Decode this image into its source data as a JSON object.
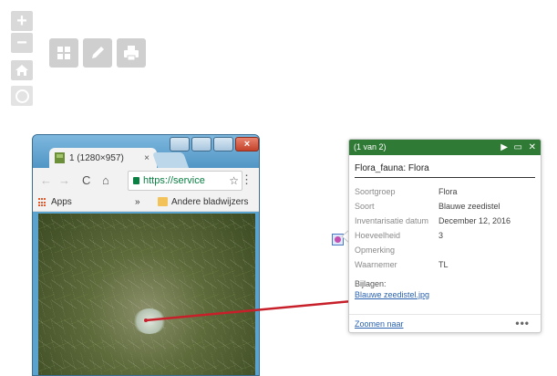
{
  "map_controls": {
    "zoom_in": "+",
    "zoom_out": "−"
  },
  "toolbar_icons": [
    "basemap-gallery-icon",
    "pencil-icon",
    "print-icon"
  ],
  "browser": {
    "tab_title": "1 (1280×957)",
    "tab_close": "×",
    "address_text": "https://service",
    "bookmarks": {
      "apps": "Apps",
      "overflow": "»",
      "other": "Andere bladwijzers"
    },
    "window_close": "×"
  },
  "popup": {
    "header": "(1 van 2)",
    "title": "Flora_fauna: Flora",
    "attributes": [
      {
        "key": "Soortgroep",
        "value": "Flora"
      },
      {
        "key": "Soort",
        "value": "Blauwe zeedistel"
      },
      {
        "key": "Inventarisatie datum",
        "value": "December 12, 2016"
      },
      {
        "key": "Hoeveelheid",
        "value": "3"
      },
      {
        "key": "Opmerking",
        "value": ""
      },
      {
        "key": "Waarnemer",
        "value": "TL"
      }
    ],
    "attachments_label": "Bijlagen:",
    "attachment": "Blauwe zeedistel.jpg",
    "zoom_link": "Zoomen naar",
    "more": "•••"
  },
  "colors": {
    "popup_header": "#2f7a34",
    "link": "#2b62b0",
    "arrow": "#c8202a"
  }
}
